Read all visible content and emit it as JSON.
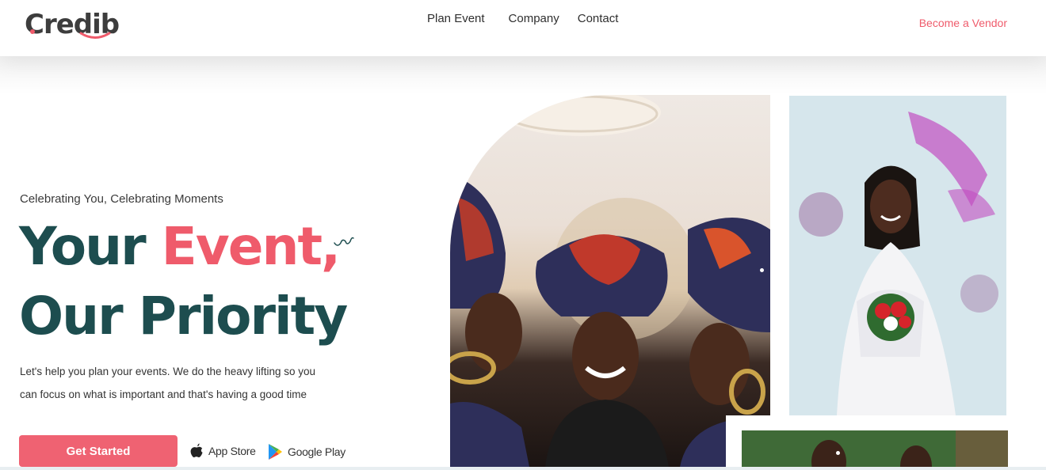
{
  "brand": {
    "logo_text": "Credib"
  },
  "nav": {
    "items": [
      {
        "label": "Plan Event"
      },
      {
        "label": "Company"
      },
      {
        "label": "Contact"
      }
    ],
    "vendor_link": "Become a Vendor"
  },
  "hero": {
    "tagline": "Celebrating You, Celebrating Moments",
    "headline_line1_plain": "Your",
    "headline_line1_accent": "Event,",
    "headline_line2": "Our Priority",
    "description_line1": "Let's help you plan your events. We do the heavy lifting so you",
    "description_line2": "can focus on what is important and that's having a good time",
    "cta_label": "Get Started",
    "app_store_label": "App Store",
    "google_play_label": "Google Play"
  },
  "colors": {
    "accent": "#ef5b6b",
    "heading": "#1d4d4f",
    "button": "#ef6272"
  },
  "icons": [
    "apple-icon",
    "google-play-icon",
    "squiggle-icon"
  ]
}
